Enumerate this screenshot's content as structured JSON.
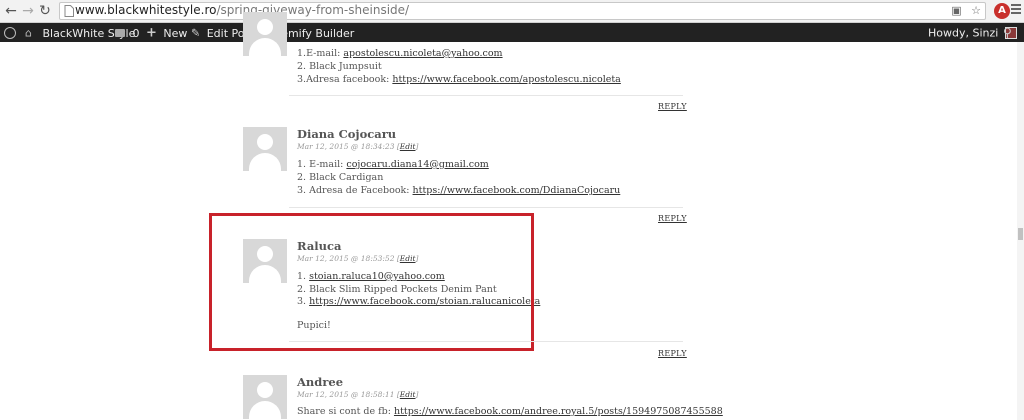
{
  "browser": {
    "url_domain": "www.blackwhitestyle.ro",
    "url_path": "/spring-giveway-from-sheinside/",
    "back_icon": "arrow-left-icon",
    "forward_icon": "arrow-right-icon",
    "reload_icon": "reload-icon",
    "home_icon": "home-icon"
  },
  "adminbar": {
    "site_name": "BlackWhite Style",
    "comments_count": "0",
    "new_label": "New",
    "edit_post_label": "Edit Post",
    "themify_label": "Themify Builder",
    "howdy_label": "Howdy, Sinzi"
  },
  "comments": [
    {
      "lines": [
        {
          "prefix": "1.E-mail: ",
          "link": "apostolescu.nicoleta@yahoo.com"
        },
        {
          "prefix": "2. Black Jumpsuit",
          "link": ""
        },
        {
          "prefix": "3.Adresa facebook: ",
          "link": "https://www.facebook.com/apostolescu.nicoleta"
        }
      ],
      "reply": "REPLY"
    },
    {
      "author": "Diana Cojocaru",
      "date": "Mar 12, 2015 @ 18:34:23",
      "edit": "Edit",
      "lines": [
        {
          "prefix": "1. E-mail: ",
          "link": "cojocaru.diana14@gmail.com"
        },
        {
          "prefix": "2. Black Cardigan",
          "link": ""
        },
        {
          "prefix": "3. Adresa de Facebook: ",
          "link": "https://www.facebook.com/DdianaCojocaru"
        }
      ],
      "reply": "REPLY"
    },
    {
      "author": "Raluca",
      "date": "Mar 12, 2015 @ 18:53:52",
      "edit": "Edit",
      "lines": [
        {
          "prefix": "1. ",
          "link": "stoian.raluca10@yahoo.com"
        },
        {
          "prefix": "2. Black Slim Ripped Pockets Denim Pant",
          "link": ""
        },
        {
          "prefix": "3. ",
          "link": "https://www.facebook.com/stoian.ralucanicoleta"
        }
      ],
      "closing": "Pupici!",
      "reply": "REPLY"
    },
    {
      "author": "Andree",
      "date": "Mar 12, 2015 @ 18:58:11",
      "edit": "Edit",
      "lines": [
        {
          "prefix": "Share si cont de fb: ",
          "link": "https://www.facebook.com/andree.royal.5/posts/1594975087455588"
        }
      ]
    }
  ],
  "colors": {
    "highlight": "#c8222a",
    "adminbar": "#222222"
  }
}
